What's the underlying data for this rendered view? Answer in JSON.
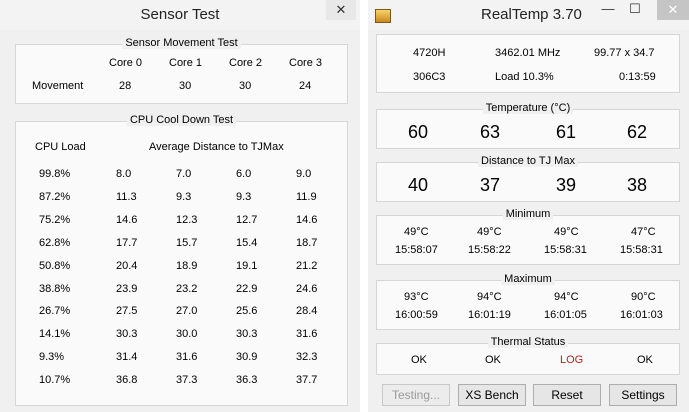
{
  "sensor_test": {
    "title": "Sensor Test",
    "close_label": "✕",
    "movement": {
      "title": "Sensor Movement Test",
      "headers": [
        "Core 0",
        "Core 1",
        "Core 2",
        "Core 3"
      ],
      "row_label": "Movement",
      "values": [
        "28",
        "30",
        "30",
        "24"
      ]
    },
    "cooldown": {
      "title": "CPU Cool Down Test",
      "col_load": "CPU Load",
      "col_avg": "Average Distance to TJMax",
      "rows": [
        [
          "99.8%",
          "8.0",
          "7.0",
          "6.0",
          "9.0"
        ],
        [
          "87.2%",
          "11.3",
          "9.3",
          "9.3",
          "11.9"
        ],
        [
          "75.2%",
          "14.6",
          "12.3",
          "12.7",
          "14.6"
        ],
        [
          "62.8%",
          "17.7",
          "15.7",
          "15.4",
          "18.7"
        ],
        [
          "50.8%",
          "20.4",
          "18.9",
          "19.1",
          "21.2"
        ],
        [
          "38.8%",
          "23.9",
          "23.2",
          "22.9",
          "24.6"
        ],
        [
          "26.7%",
          "27.5",
          "27.0",
          "25.6",
          "28.4"
        ],
        [
          "14.1%",
          "30.3",
          "30.0",
          "30.3",
          "31.6"
        ],
        [
          "9.3%",
          "31.4",
          "31.6",
          "30.9",
          "32.3"
        ],
        [
          "10.7%",
          "36.8",
          "37.3",
          "36.3",
          "37.7"
        ]
      ]
    }
  },
  "realtemp": {
    "title": "RealTemp 3.70",
    "minimize_label": "—",
    "maximize_label": "☐",
    "close_label": "✕",
    "info": {
      "cpu": "4720H",
      "mhz": "3462.01 MHz",
      "multiplier": "99.77 x 34.7",
      "cpuid": "306C3",
      "load": "Load  10.3%",
      "time": "0:13:59"
    },
    "temperature": {
      "title": "Temperature (°C)",
      "values": [
        "60",
        "63",
        "61",
        "62"
      ]
    },
    "distance": {
      "title": "Distance to TJ Max",
      "values": [
        "40",
        "37",
        "39",
        "38"
      ]
    },
    "minimum": {
      "title": "Minimum",
      "temps": [
        "49°C",
        "49°C",
        "49°C",
        "47°C"
      ],
      "times": [
        "15:58:07",
        "15:58:22",
        "15:58:31",
        "15:58:31"
      ]
    },
    "maximum": {
      "title": "Maximum",
      "temps": [
        "93°C",
        "94°C",
        "94°C",
        "90°C"
      ],
      "times": [
        "16:00:59",
        "16:01:19",
        "16:01:05",
        "16:01:03"
      ]
    },
    "thermal": {
      "title": "Thermal Status",
      "values": [
        "OK",
        "OK",
        "LOG",
        "OK"
      ]
    },
    "buttons": {
      "testing": "Testing...",
      "xs_bench": "XS Bench",
      "reset": "Reset",
      "settings": "Settings"
    },
    "colors": {
      "log_status": "#b22222"
    }
  }
}
